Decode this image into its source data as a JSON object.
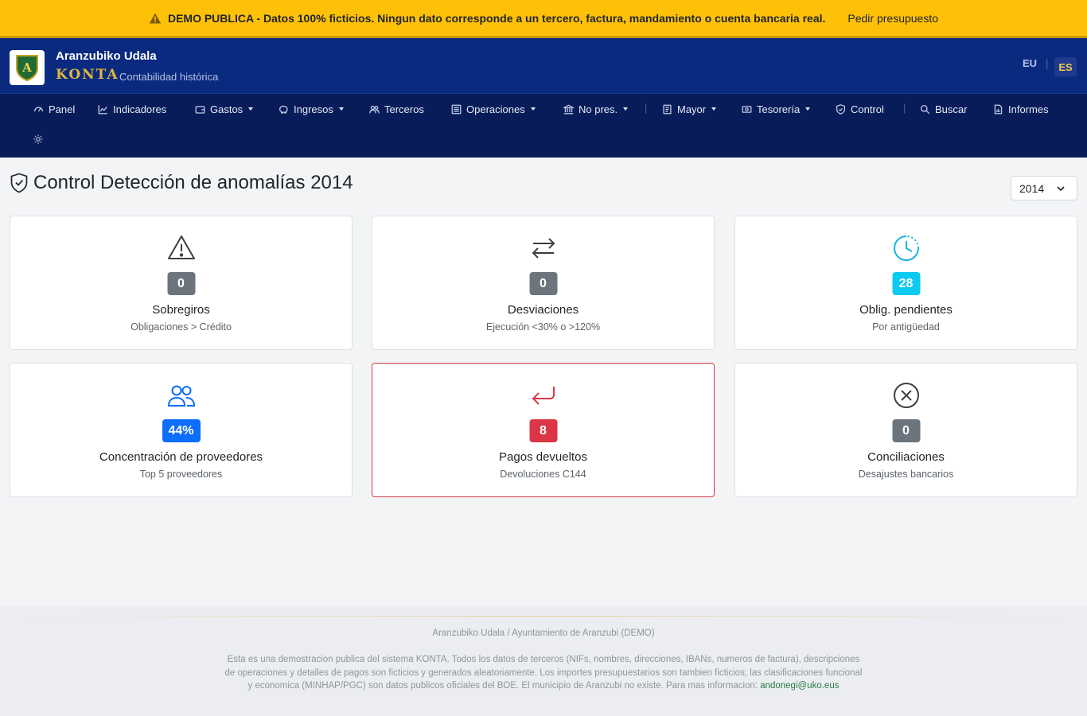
{
  "banner": {
    "text": "DEMO PUBLICA - Datos 100% ficticios. Ningun dato corresponde a un tercero, factura, mandamiento o cuenta bancaria real.",
    "link": "Pedir presupuesto",
    "icon": "warning-triangle-icon"
  },
  "header": {
    "logo_letter": "A",
    "org_name": "Aranzubiko Udala",
    "brand": "KONTA",
    "subtitle": "Contabilidad histórica",
    "lang_eu": "EU",
    "lang_sep": "|",
    "lang_es": "ES"
  },
  "nav": {
    "panel": "Panel",
    "indicadores": "Indicadores",
    "gastos": "Gastos",
    "ingresos": "Ingresos",
    "terceros": "Terceros",
    "operaciones": "Operaciones",
    "no_pres": "No pres.",
    "sep1": "|",
    "mayor": "Mayor",
    "tesoreria": "Tesorería",
    "control": "Control",
    "sep2": "|",
    "buscar": "Buscar",
    "informes": "Informes"
  },
  "page": {
    "title": "Control Detección de anomalías 2014",
    "year": "2014"
  },
  "cards": [
    {
      "icon": "warning-icon",
      "value": "0",
      "title": "Sobregiros",
      "sub": "Obligaciones > Crédito",
      "badge_color": "#6c757d"
    },
    {
      "icon": "swap-arrows-icon",
      "value": "0",
      "title": "Desviaciones",
      "sub": "Ejecución <30% o >120%",
      "badge_color": "#6c757d"
    },
    {
      "icon": "clock-history-icon",
      "value": "28",
      "title": "Oblig. pendientes",
      "sub": "Por antigüedad",
      "badge_color": "#0dcaf0"
    },
    {
      "icon": "people-icon",
      "value": "44%",
      "title": "Concentración de proveedores",
      "sub": "Top 5 proveedores",
      "badge_color": "#0d6efd"
    },
    {
      "icon": "return-arrow-icon",
      "value": "8",
      "title": "Pagos devueltos",
      "sub": "Devoluciones C144",
      "badge_color": "#dc3545"
    },
    {
      "icon": "x-circle-icon",
      "value": "0",
      "title": "Conciliaciones",
      "sub": "Desajustes bancarios",
      "badge_color": "#6c757d"
    }
  ],
  "footer": {
    "org": "Aranzubiko Udala / Ayuntamiento de Aranzubi (DEMO)",
    "note": "Esta es una demostracion publica del sistema KONTA. Todos los datos de terceros (NIFs, nombres, direcciones, IBANs, numeros de factura), descripciones de operaciones y detalles de pagos son ficticios y generados aleatoriamente. Los importes presupuestarios son tambien ficticios; las clasificaciones funcional y economica (MINHAP/PGC) son datos publicos oficiales del BOE. El municipio de Aranzubi no existe. Para mas informacion:",
    "email": "andonegi@uko.eus"
  }
}
